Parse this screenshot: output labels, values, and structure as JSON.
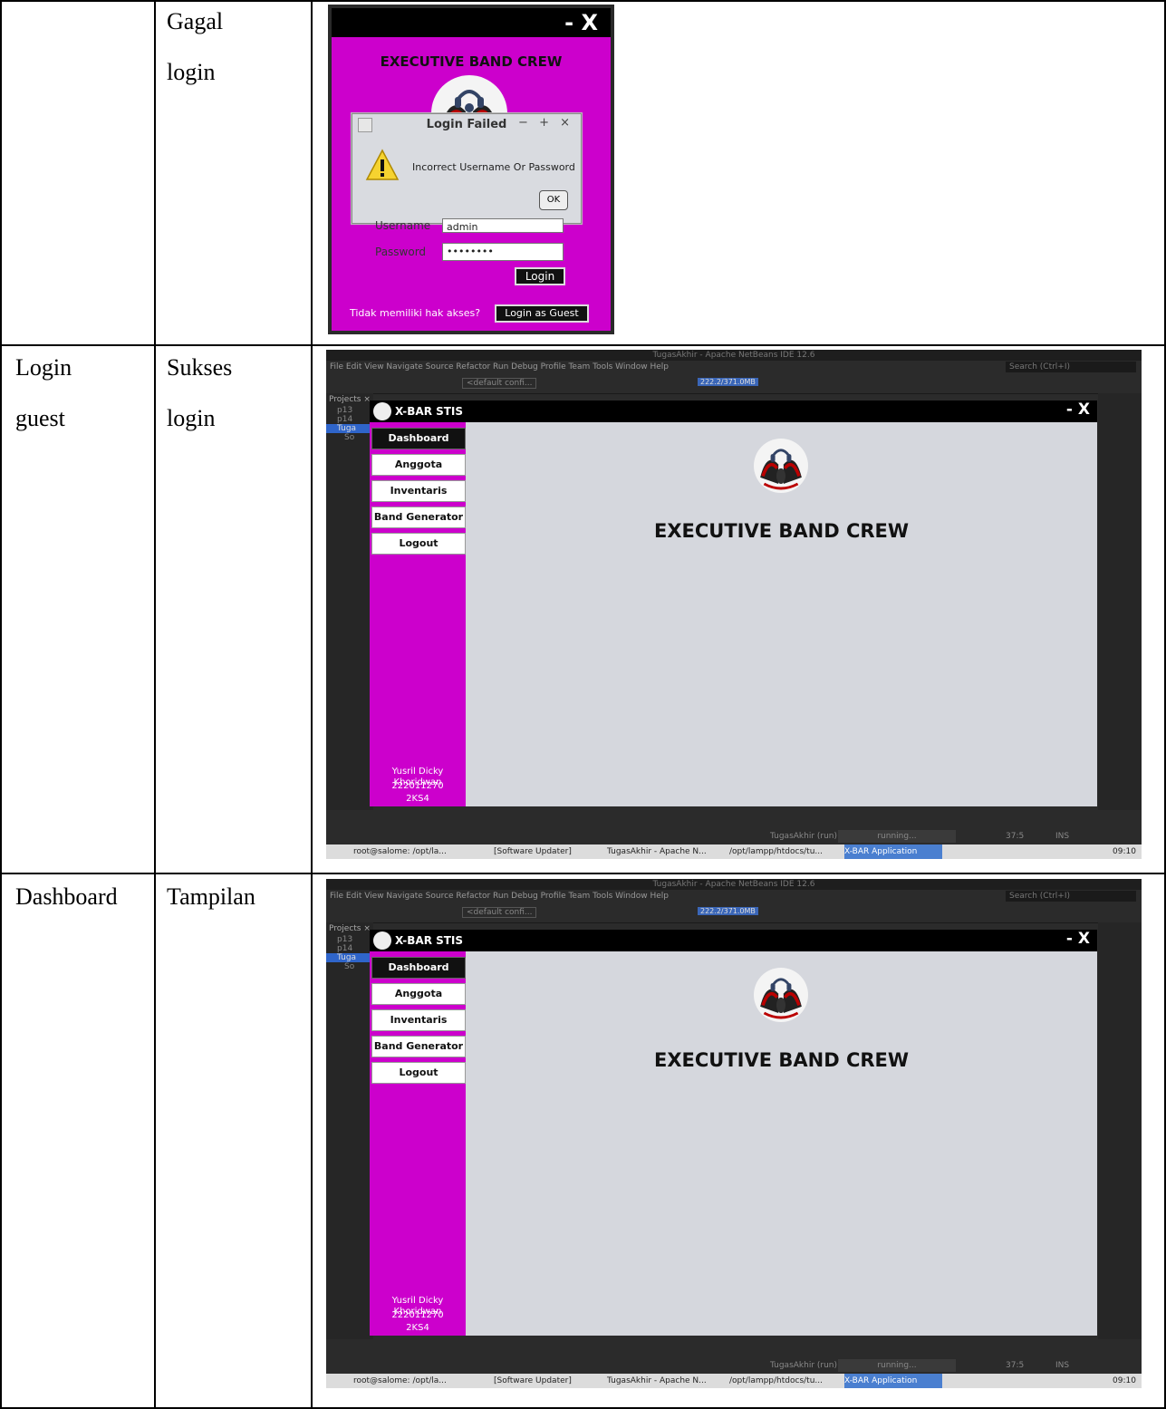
{
  "rows": [
    {
      "col1": "",
      "col2": [
        "Gagal",
        "login"
      ]
    },
    {
      "col1": [
        "Login",
        "guest"
      ],
      "col2": [
        "Sukses",
        "login"
      ]
    },
    {
      "col1": [
        "Dashboard"
      ],
      "col2": [
        "Tampilan"
      ]
    }
  ],
  "login_window": {
    "close_label": "- X",
    "heading": "EXECUTIVE BAND CREW",
    "dialog": {
      "title": "Login Failed",
      "controls": "− + ×",
      "message": "Incorrect Username Or Password",
      "ok_label": "OK"
    },
    "username_label": "Username",
    "username_value": "admin",
    "password_label": "Password",
    "password_value": "••••••••",
    "login_button": "Login",
    "guest_prompt": "Tidak memiliki hak akses?",
    "guest_button": "Login as Guest"
  },
  "ide": {
    "title": "TugasAkhir - Apache NetBeans IDE 12.6",
    "menu": "File   Edit   View   Navigate   Source   Refactor   Run   Debug   Profile   Team   Tools   Window   Help",
    "search_placeholder": "Search (Ctrl+I)",
    "config": "<default confi...",
    "memory": "222.2/371.0MB",
    "projects_tab": "Projects ×",
    "tree_items": [
      "p13",
      "p14",
      "Tuga",
      "So"
    ],
    "status_run": "TugasAkhir (run)",
    "status_running": "running...",
    "status_pos": "37:5",
    "status_ins": "INS"
  },
  "app": {
    "title": "X-BAR STIS",
    "close_label": "- X",
    "nav": [
      "Dashboard",
      "Anggota",
      "Inventaris",
      "Band Generator",
      "Logout"
    ],
    "footer_name": "Yusril Dicky Khoridwan",
    "footer_nim": "222011270",
    "footer_class": "2KS4",
    "heading": "EXECUTIVE BAND CREW"
  },
  "taskbar": {
    "items": [
      "root@salome: /opt/la...",
      "[Software Updater]",
      "TugasAkhir - Apache N...",
      "/opt/lampp/htdocs/tu...",
      "X-BAR Application"
    ],
    "clock": "09:10"
  },
  "colors": {
    "magenta": "#cc00cc",
    "panel": "#d5d7dd"
  }
}
